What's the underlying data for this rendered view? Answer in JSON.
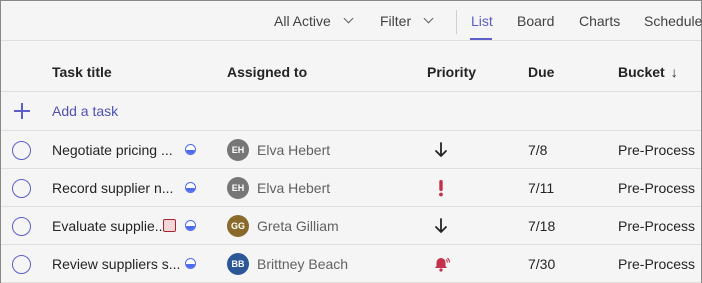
{
  "toolbar": {
    "filter_scope": "All Active",
    "filter": "Filter",
    "tabs": [
      {
        "label": "List",
        "active": true
      },
      {
        "label": "Board",
        "active": false
      },
      {
        "label": "Charts",
        "active": false
      },
      {
        "label": "Schedule",
        "active": false
      }
    ]
  },
  "columns": {
    "title": "Task title",
    "assigned": "Assigned to",
    "priority": "Priority",
    "due": "Due",
    "bucket": "Bucket",
    "bucket_sort": "↓"
  },
  "add_task": "Add a task",
  "tasks": [
    {
      "title": "Negotiate pricing ...",
      "has_label": false,
      "progress": "in-progress",
      "avatar_initials": "EH",
      "avatar_color": "#767676",
      "assignee": "Elva Hebert",
      "priority": "low",
      "due": "7/8",
      "bucket": "Pre-Process"
    },
    {
      "title": "Record supplier n...",
      "has_label": false,
      "progress": "in-progress",
      "avatar_initials": "EH",
      "avatar_color": "#767676",
      "assignee": "Elva Hebert",
      "priority": "important",
      "due": "7/11",
      "bucket": "Pre-Process"
    },
    {
      "title": "Evaluate supplie...",
      "has_label": true,
      "progress": "in-progress",
      "avatar_initials": "GG",
      "avatar_color": "#8a6a2a",
      "assignee": "Greta Gilliam",
      "priority": "low",
      "due": "7/18",
      "bucket": "Pre-Process"
    },
    {
      "title": "Review suppliers s...",
      "has_label": false,
      "progress": "in-progress",
      "avatar_initials": "BB",
      "avatar_color": "#2b5797",
      "assignee": "Brittney Beach",
      "priority": "urgent",
      "due": "7/30",
      "bucket": "Pre-Process"
    }
  ],
  "colors": {
    "accent": "#5b5fc7",
    "important": "#c4314b",
    "urgent": "#c4314b",
    "progress": "#4f6bed"
  }
}
